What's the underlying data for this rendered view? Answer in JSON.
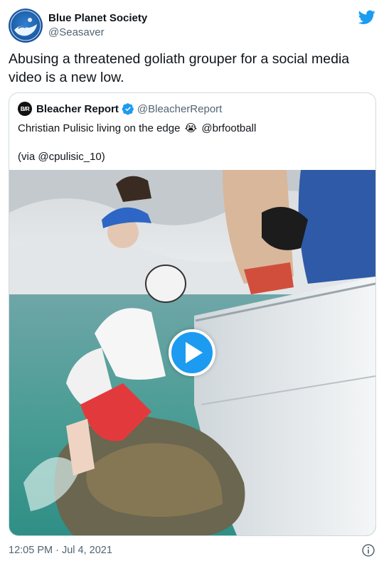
{
  "author": {
    "display_name": "Blue Planet Society",
    "handle": "@Seasaver",
    "avatar_icon": "blue-planet-logo",
    "brand_icon": "twitter-bird-icon"
  },
  "tweet": {
    "text": "Abusing a threatened goliath grouper for a social media video is a new low."
  },
  "quote": {
    "logo_text": "B/R",
    "display_name": "Bleacher Report",
    "handle": "@BleacherReport",
    "line1_text": "Christian Pulisic living on the edge",
    "line1_emoji": "😭",
    "line1_mention": "@brfootball",
    "line2_text": "(via @cpulisic_10)"
  },
  "media": {
    "play_icon": "play-icon"
  },
  "footer": {
    "timestamp": "12:05 PM · Jul 4, 2021",
    "info_icon": "info-icon"
  },
  "colors": {
    "accent": "#1d9bf0",
    "text": "#0f1419",
    "secondary_text": "#536471",
    "border": "#cfd9de"
  }
}
